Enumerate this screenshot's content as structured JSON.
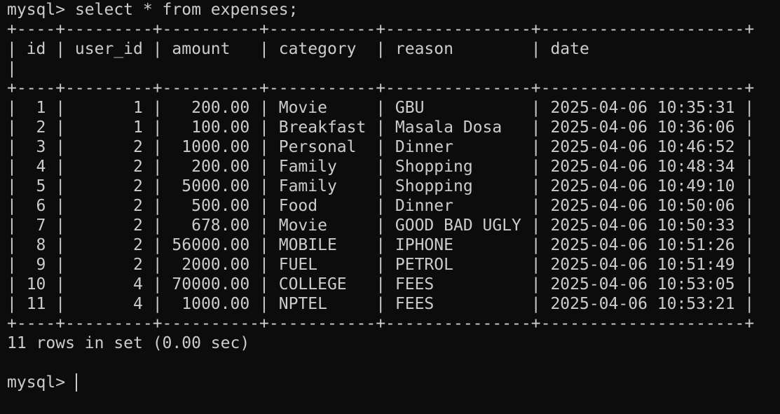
{
  "terminal": {
    "command_prompt": "mysql> ",
    "command": "select * from expenses;",
    "border": "+----+---------+----------+-----------+---------------+---------------------+",
    "header_cells": "| id | user_id | amount   | category  | reason        | date",
    "header_tail": "|",
    "rows": [
      "|  1 |       1 |   200.00 | Movie     | GBU           | 2025-04-06 10:35:31 |",
      "|  2 |       1 |   100.00 | Breakfast | Masala Dosa   | 2025-04-06 10:36:06 |",
      "|  3 |       2 |  1000.00 | Personal  | Dinner        | 2025-04-06 10:46:52 |",
      "|  4 |       2 |   200.00 | Family    | Shopping      | 2025-04-06 10:48:34 |",
      "|  5 |       2 |  5000.00 | Family    | Shopping      | 2025-04-06 10:49:10 |",
      "|  6 |       2 |   500.00 | Food      | Dinner        | 2025-04-06 10:50:06 |",
      "|  7 |       2 |   678.00 | Movie     | GOOD BAD UGLY | 2025-04-06 10:50:33 |",
      "|  8 |       2 | 56000.00 | MOBILE    | IPHONE        | 2025-04-06 10:51:26 |",
      "|  9 |       2 |  2000.00 | FUEL      | PETROL        | 2025-04-06 10:51:49 |",
      "| 10 |       4 | 70000.00 | COLLEGE   | FEES          | 2025-04-06 10:53:05 |",
      "| 11 |       4 |  1000.00 | NPTEL     | FEES          | 2025-04-06 10:53:21 |"
    ],
    "result_summary": "11 rows in set (0.00 sec)",
    "final_prompt": "mysql> "
  },
  "colors": {
    "background": "#0c0c0c",
    "text": "#cccccc"
  }
}
